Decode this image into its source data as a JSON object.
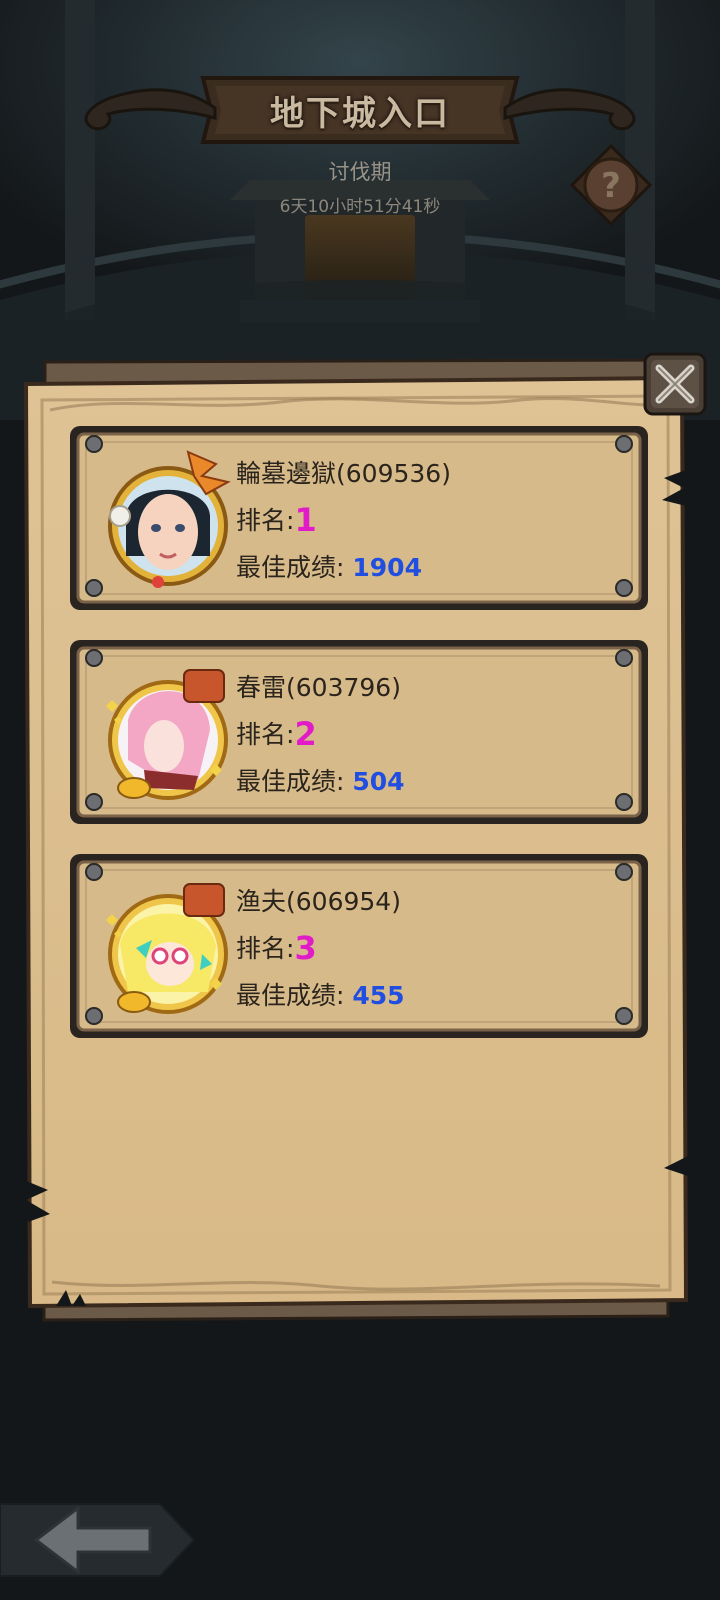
{
  "header": {
    "title": "地下城入口",
    "period_label": "讨伐期",
    "period_countdown": "6天10小时51分41秒"
  },
  "leaderboard": {
    "rank_label": "排名:",
    "score_label": "最佳成绩:",
    "entries": [
      {
        "name": "輪墓邊獄(609536)",
        "rank": "1",
        "score": "1904"
      },
      {
        "name": "春雷(603796)",
        "rank": "2",
        "score": "504"
      },
      {
        "name": "渔夫(606954)",
        "rank": "3",
        "score": "455"
      }
    ]
  },
  "icons": {
    "help": "question-mark-icon",
    "close": "crossed-swords-close-icon",
    "back": "left-arrow-icon"
  },
  "colors": {
    "parchment": "#dcc08f",
    "rank_value": "#e21bc8",
    "score_value": "#1f4ee0",
    "card_border": "#2a2420"
  }
}
